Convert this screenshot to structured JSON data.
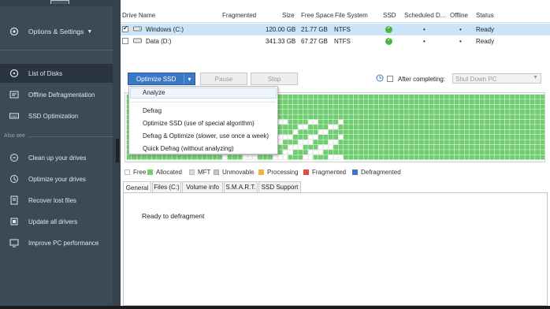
{
  "sidebar": {
    "main_menu": "Options & Settings",
    "items": [
      {
        "label": "List of Disks",
        "icon": "disk-list-icon",
        "active": true
      },
      {
        "label": "Offline Defragmentation",
        "icon": "offline-defrag-icon"
      },
      {
        "label": "SSD Optimization",
        "icon": "ssd-icon"
      }
    ],
    "also_see": "Also see",
    "also_items": [
      {
        "label": "Clean up your drives",
        "icon": "cleanup-icon"
      },
      {
        "label": "Optimize your drives",
        "icon": "optimize-icon"
      },
      {
        "label": "Recover lost files",
        "icon": "recover-icon"
      },
      {
        "label": "Update all drivers",
        "icon": "drivers-icon"
      },
      {
        "label": "Improve PC performance",
        "icon": "performance-icon"
      }
    ]
  },
  "table": {
    "columns": [
      "Drive Name",
      "Fragmented",
      "Size",
      "Free Space",
      "File System",
      "SSD",
      "Scheduled D...",
      "Offline",
      "Status"
    ],
    "rows": [
      {
        "checked": true,
        "name": "Windows (C:)",
        "fragmented": "",
        "size": "120.00 GB",
        "free": "21.77 GB",
        "fs": "NTFS",
        "ssd": "ok",
        "scheduled": "•",
        "offline": "•",
        "status": "Ready"
      },
      {
        "checked": false,
        "name": "Data (D:)",
        "fragmented": "",
        "size": "341.33 GB",
        "free": "67.27 GB",
        "fs": "NTFS",
        "ssd": "ok",
        "scheduled": "•",
        "offline": "•",
        "status": "Ready"
      }
    ]
  },
  "toolbar": {
    "primary": "Optimize SSD",
    "pause": "Pause",
    "stop": "Stop",
    "after_label": "After completing:",
    "after_value": "Shut Down PC"
  },
  "dropdown": {
    "items": [
      "Analyze",
      "Defrag",
      "Optimize SSD (use of special algorithm)",
      "Defrag & Optimize (slower, use once a week)",
      "Quick Defrag (without analyzing)"
    ]
  },
  "legend": [
    {
      "label": "Free",
      "color": "#ffffff"
    },
    {
      "label": "Allocated",
      "color": "#6fd06f"
    },
    {
      "label": "MFT",
      "color": "#d8d8d8"
    },
    {
      "label": "Unmovable",
      "color": "#c8c8c8"
    },
    {
      "label": "Processing",
      "color": "#f2b14a"
    },
    {
      "label": "Fragmented",
      "color": "#e24b3b"
    },
    {
      "label": "Defragmented",
      "color": "#3b78c4"
    }
  ],
  "tabs": [
    "General",
    "Files (C:)",
    "Volume info",
    "S.M.A.R.T.",
    "SSD Support"
  ],
  "status": {
    "message": "Ready to defragment"
  },
  "colors": {
    "sidebar": "#3c4a57",
    "accent": "#3a78c6",
    "allocated": "#6fd06f",
    "ssd_ok": "#4bb543"
  }
}
